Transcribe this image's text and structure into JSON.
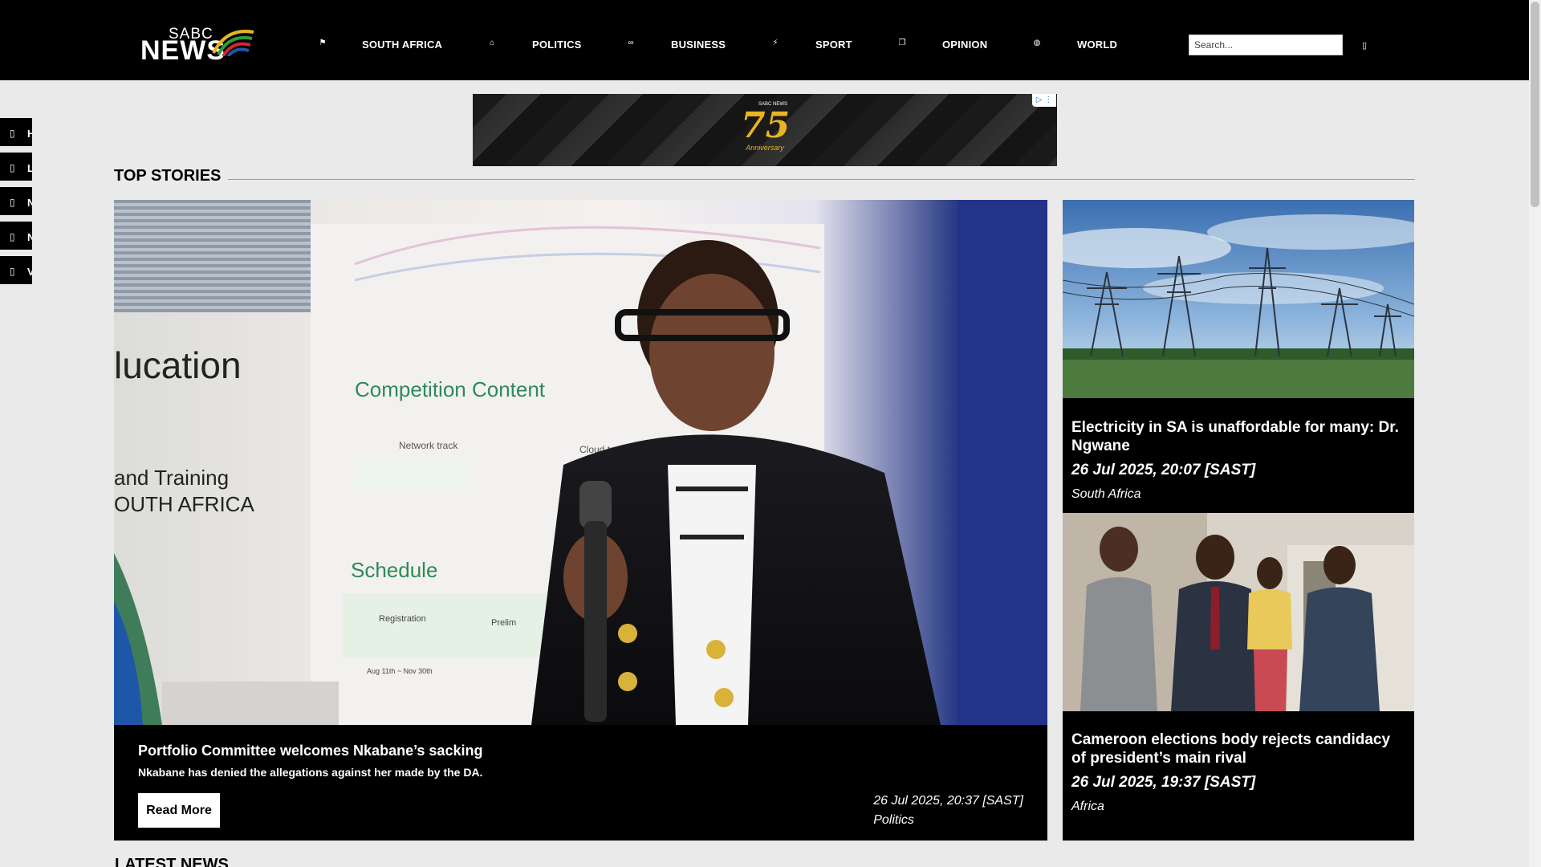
{
  "brand": {
    "sabc": "SABC",
    "news": "NEWS",
    "colors": {
      "black": "#000000",
      "background": "#eaeaea",
      "gold": "#e8b520",
      "green": "#2e9d3a",
      "red": "#d6262d",
      "blue": "#1f57a8"
    }
  },
  "nav": {
    "items": [
      {
        "label": "SOUTH AFRICA",
        "icon": "flag-icon"
      },
      {
        "label": "POLITICS",
        "icon": "parliament-icon"
      },
      {
        "label": "BUSINESS",
        "icon": "handshake-icon"
      },
      {
        "label": "SPORT",
        "icon": "runner-icon"
      },
      {
        "label": "OPINION",
        "icon": "chat-icon"
      },
      {
        "label": "WORLD",
        "icon": "globe-icon"
      }
    ],
    "search": {
      "placeholder": "Search...",
      "value": "",
      "button_icon": "search-icon"
    }
  },
  "side_tabs": [
    {
      "initial": "H"
    },
    {
      "initial": "L"
    },
    {
      "initial": "N"
    },
    {
      "initial": "N"
    },
    {
      "initial": "V"
    }
  ],
  "ad": {
    "badge_number": "75",
    "badge_text": "Anniversary",
    "badge_brand": "SABC NEWS"
  },
  "sections": {
    "top_stories": "TOP STORIES",
    "latest_news": "LATEST NEWS"
  },
  "main_story": {
    "headline": "Portfolio Committee welcomes Nkabane’s sacking",
    "summary": "Nkabane has denied the allegations against her made by the DA.",
    "read_more": "Read More",
    "date": "26 Jul 2025, 20:37 [SAST]",
    "category": "Politics",
    "image_text": {
      "line1": "lucation",
      "line2": "and Training",
      "line3": "OUTH AFRICA",
      "board_title": "Competition Content",
      "board_col1": "Network track",
      "board_col2": "Cloud track",
      "board_schedule": "Schedule",
      "board_reg": "Registration",
      "board_pre": "Prelim",
      "board_date": "Aug 11th ~ Nov 30th"
    }
  },
  "side_stories": [
    {
      "headline": "Electricity in SA is unaffordable for many: Dr. Ngwane",
      "date": "26 Jul 2025, 20:07 [SAST]",
      "category": "South Africa"
    },
    {
      "headline": "Cameroon elections body rejects candidacy of president’s main rival",
      "date": "26 Jul 2025, 19:37 [SAST]",
      "category": "Africa"
    }
  ]
}
